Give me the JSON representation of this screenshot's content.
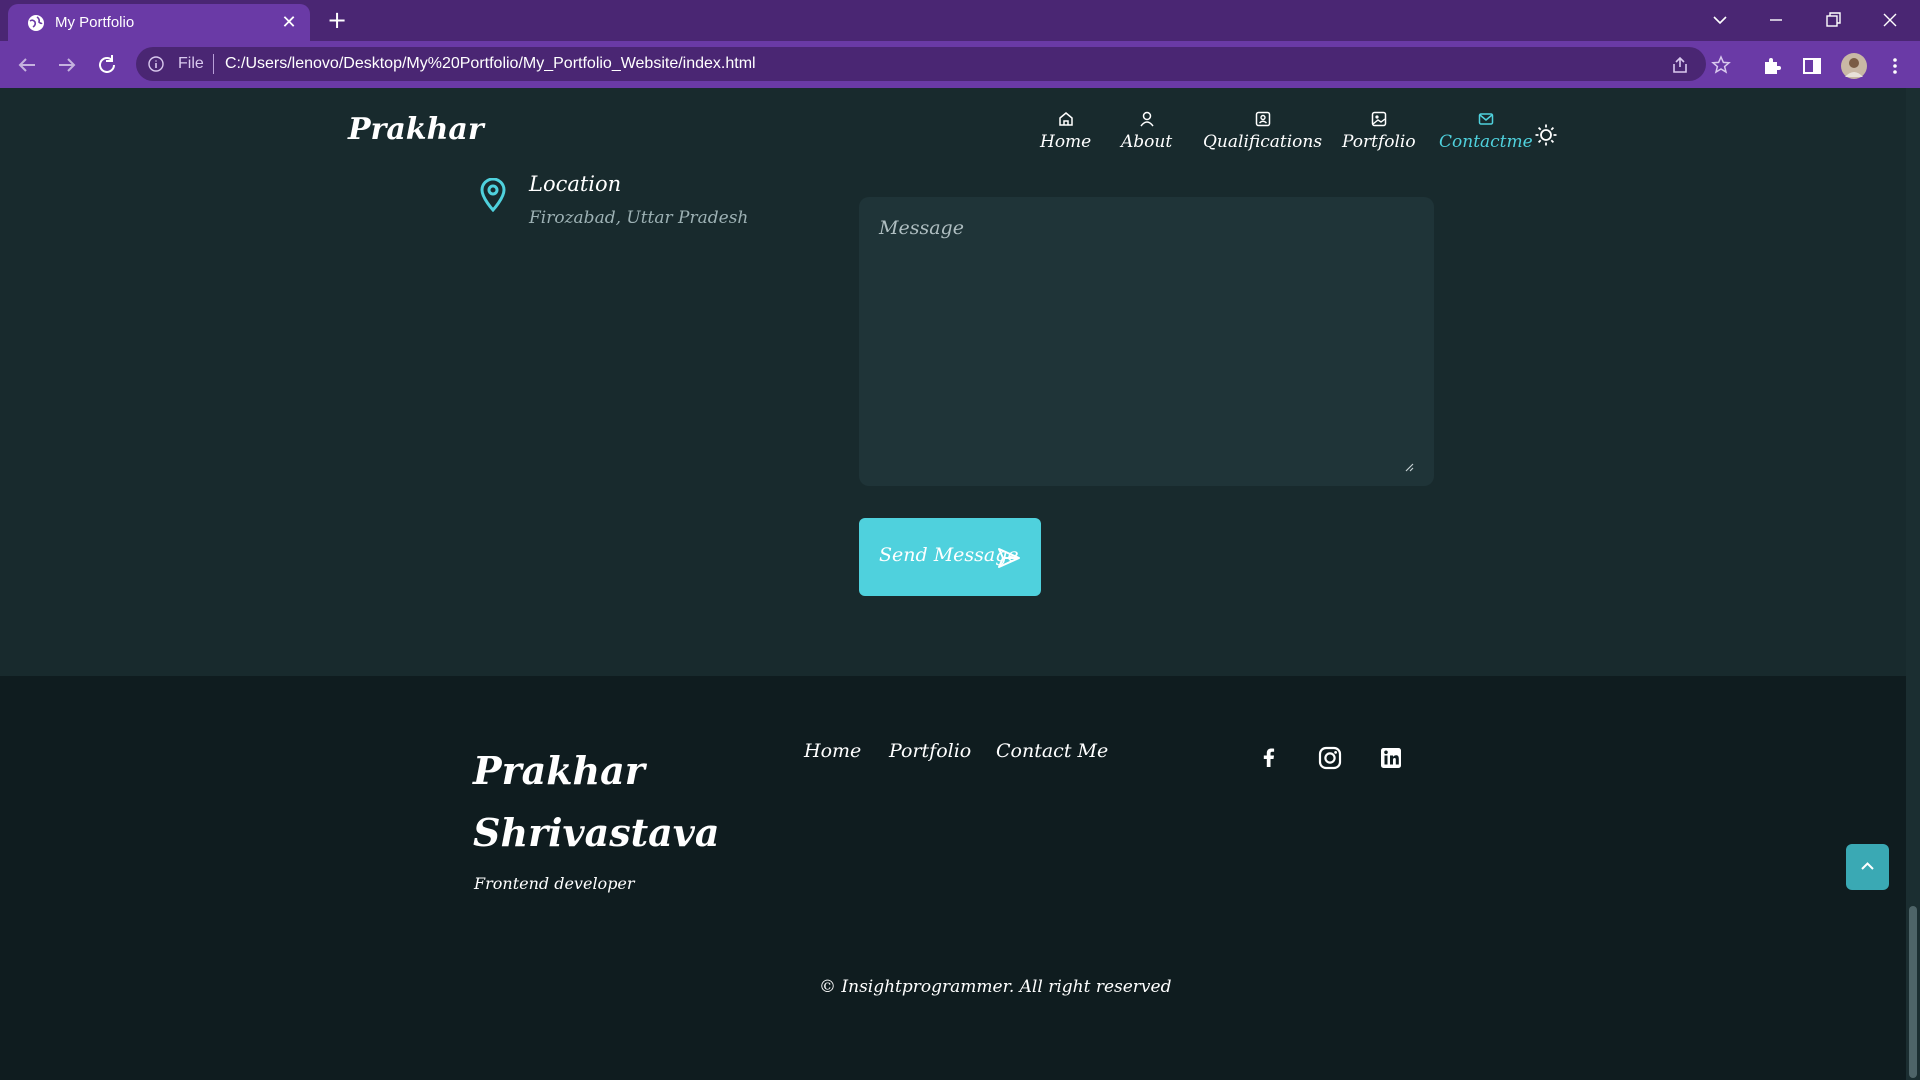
{
  "browser": {
    "tab_title": "My Portfolio",
    "omnibox": {
      "scheme_label": "File",
      "url": "C:/Users/lenovo/Desktop/My%20Portfolio/My_Portfolio_Website/index.html"
    },
    "icons": [
      "globe-icon",
      "close-icon",
      "plus-icon",
      "back-icon",
      "forward-icon",
      "reload-icon",
      "info-icon",
      "share-icon",
      "star-icon",
      "extensions-icon",
      "sidepanel-icon",
      "profile-avatar",
      "kebab-menu-icon",
      "minimize-icon",
      "restore-icon",
      "tab-search-icon"
    ],
    "colors": {
      "frame": "#4a2673",
      "toolbar": "#6a3aa6"
    }
  },
  "header": {
    "logo": "Prakhar",
    "nav": [
      {
        "label": "Home",
        "icon": "home-icon"
      },
      {
        "label": "About",
        "icon": "user-icon"
      },
      {
        "label": "Qualifications",
        "icon": "id-card-icon"
      },
      {
        "label": "Portfolio",
        "icon": "image-icon"
      },
      {
        "label": "Contactme",
        "icon": "mail-icon",
        "active": true
      }
    ],
    "theme_toggle_icon": "sun-icon"
  },
  "contact": {
    "location": {
      "title": "Location",
      "value": "Firozabad, Uttar Pradesh",
      "icon": "map-pin-icon"
    },
    "message_placeholder": "Message",
    "send_label": "Send Message",
    "send_icon": "send-icon"
  },
  "footer": {
    "name": "Prakhar Shrivastava",
    "role": "Frontend developer",
    "links": [
      "Home",
      "Portfolio",
      "Contact Me"
    ],
    "socials": [
      "facebook-icon",
      "instagram-icon",
      "linkedin-icon"
    ],
    "copyright": "© Insightprogrammer. All right reserved",
    "scroll_up_icon": "chevron-up-icon"
  },
  "theme": {
    "accent": "#4fd1dd",
    "page_bg": "#182a2d",
    "footer_bg": "#0f1c1f",
    "input_bg": "#1f3438"
  }
}
